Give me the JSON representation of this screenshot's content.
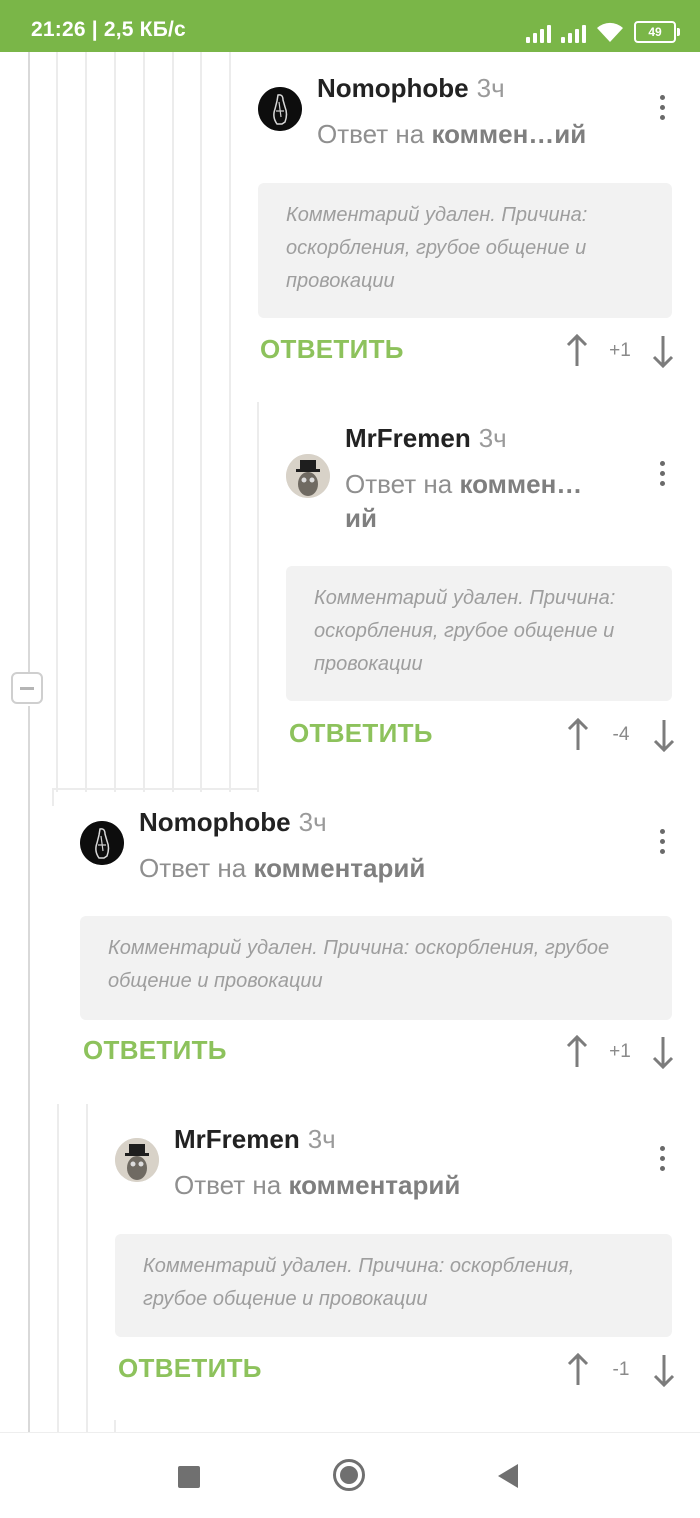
{
  "status_bar": {
    "time_speed": "21:26 | 2,5 КБ/с",
    "battery": "49"
  },
  "comments": [
    {
      "author": "Nomophobe",
      "time": "3ч",
      "reply_prefix": "Ответ на",
      "reply_target": "коммен…ий",
      "avatar": "dark-figure-avatar",
      "deleted_text": "Комментарий удален. Причина: оскорбления, грубое общение и провокации",
      "reply_label": "ОТВЕТИТЬ",
      "score": "+1"
    },
    {
      "author": "MrFremen",
      "time": "3ч",
      "reply_prefix": "Ответ на",
      "reply_target": "коммен…\nий",
      "avatar": "top-hat-avatar",
      "deleted_text": "Комментарий удален. Причина: оскорбления, грубое общение и провокации",
      "reply_label": "ОТВЕТИТЬ",
      "score": "-4"
    },
    {
      "author": "Nomophobe",
      "time": "3ч",
      "reply_prefix": "Ответ на",
      "reply_target": "комментарий",
      "avatar": "dark-figure-avatar",
      "deleted_text": "Комментарий удален. Причина: оскорбления, грубое общение и провокации",
      "reply_label": "ОТВЕТИТЬ",
      "score": "+1"
    },
    {
      "author": "MrFremen",
      "time": "3ч",
      "reply_prefix": "Ответ на",
      "reply_target": "комментарий",
      "avatar": "top-hat-avatar",
      "deleted_text": "Комментарий удален. Причина: оскорбления, грубое общение и провокации",
      "reply_label": "ОТВЕТИТЬ",
      "score": "-1"
    }
  ],
  "colors": {
    "status_bar": "#7ab648",
    "accent": "#8dc25c",
    "deleted_bg": "#f2f2f2"
  },
  "icons": [
    "signal-icon",
    "wifi-icon",
    "battery-icon",
    "kebab-menu-icon",
    "upvote-icon",
    "downvote-icon",
    "collapse-icon",
    "nav-recents-icon",
    "nav-home-icon",
    "nav-back-icon"
  ]
}
